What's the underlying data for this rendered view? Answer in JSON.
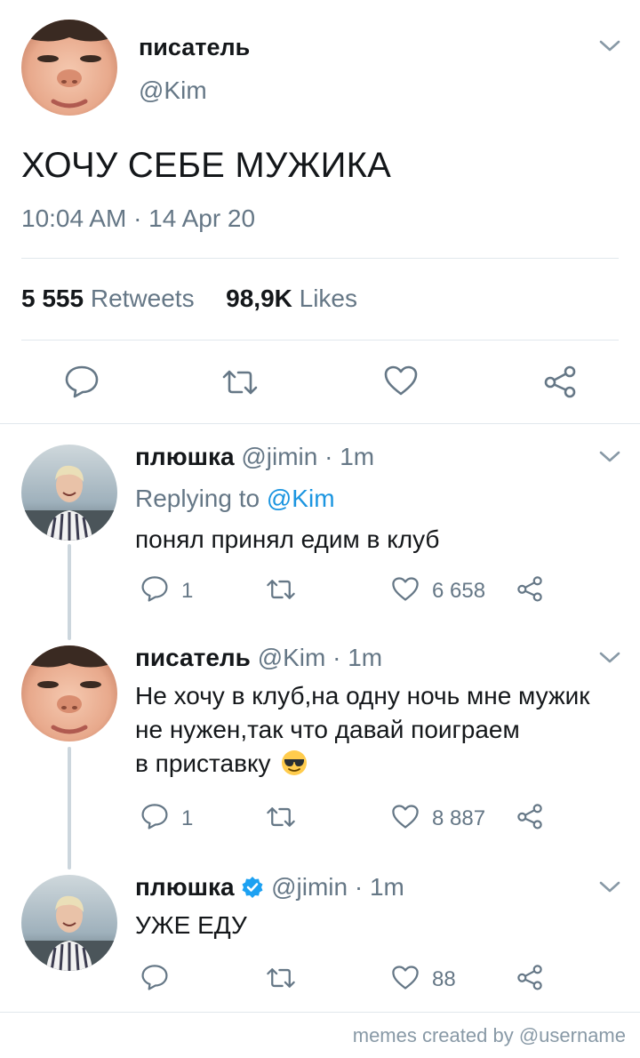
{
  "main_tweet": {
    "author_name": "писатель",
    "handle": "@Kim",
    "text": "ХОЧУ СЕБЕ МУЖИКА",
    "timestamp": "10:04 AM · 14 Apr 20",
    "retweets_count": "5 555",
    "retweets_label": "Retweets",
    "likes_count": "98,9K",
    "likes_label": "Likes"
  },
  "replies": [
    {
      "author_name": "плюшка",
      "handle": "@jimin · 1m",
      "replying_prefix": "Replying to",
      "replying_handle": "@Kim",
      "lines": [
        "понял принял едим в клуб"
      ],
      "reply_count": "1",
      "like_count": "6 658"
    },
    {
      "author_name": "писатель",
      "handle": "@Kim · 1m",
      "lines": [
        "Не хочу в клуб,на одну ночь мне мужик",
        "не нужен,так что давай поиграем",
        "в приставку"
      ],
      "emoji": "😎",
      "reply_count": "1",
      "like_count": "8 887"
    },
    {
      "author_name": "плюшка",
      "verified": true,
      "handle": "@jimin · 1m",
      "lines": [
        "УЖЕ ЕДУ"
      ],
      "reply_count": "",
      "like_count": "88"
    }
  ],
  "footer": {
    "watermark": "memes created by @username"
  },
  "colors": {
    "icon_gray": "#657786",
    "link_blue": "#1b95e0",
    "divider": "#e1e8ed",
    "thread_line": "#ccd6dd"
  }
}
